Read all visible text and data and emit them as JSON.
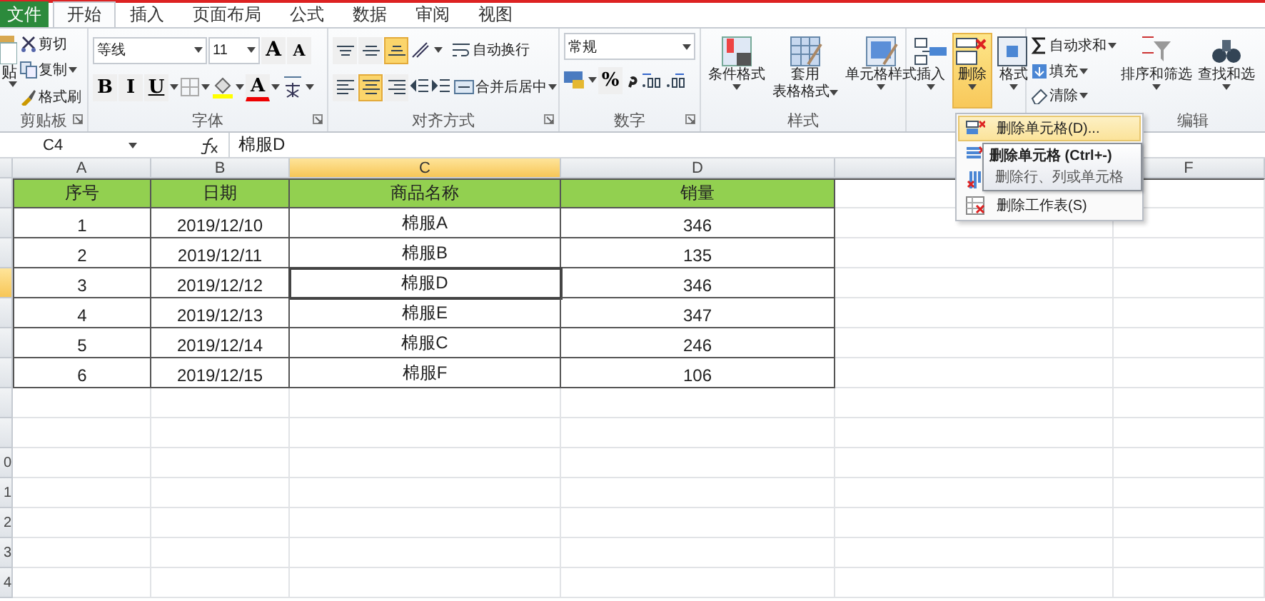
{
  "ribbon_tabs": [
    {
      "label": "文件",
      "kind": "file",
      "selected": false
    },
    {
      "label": "开始",
      "kind": "tab",
      "selected": true
    },
    {
      "label": "插入",
      "kind": "tab",
      "selected": false
    },
    {
      "label": "页面布局",
      "kind": "tab",
      "selected": false
    },
    {
      "label": "公式",
      "kind": "tab",
      "selected": false
    },
    {
      "label": "数据",
      "kind": "tab",
      "selected": false
    },
    {
      "label": "审阅",
      "kind": "tab",
      "selected": false
    },
    {
      "label": "视图",
      "kind": "tab",
      "selected": false
    }
  ],
  "clipboard": {
    "paste": "贴",
    "cut": "剪切",
    "copy": "复制",
    "format_painter": "格式刷",
    "label": "剪贴板"
  },
  "font": {
    "name": "等线",
    "size": "11",
    "grow": "A",
    "shrink": "A",
    "bold": "B",
    "italic": "I",
    "underline": "U",
    "font_color": "A",
    "label": "字体"
  },
  "alignment": {
    "vertical": [
      {
        "kind": "top",
        "selected": false
      },
      {
        "kind": "middle",
        "selected": false
      },
      {
        "kind": "bottom",
        "selected": true
      }
    ],
    "horizontal": [
      {
        "kind": "left",
        "selected": false
      },
      {
        "kind": "center",
        "selected": true
      },
      {
        "kind": "right",
        "selected": false
      }
    ],
    "wrap": "自动换行",
    "merge": "合并后居中",
    "label": "对齐方式"
  },
  "number": {
    "format": "常规",
    "percent": "%",
    "label": "数字"
  },
  "styles": {
    "buttons": [
      {
        "kind": "conditional",
        "lines": [
          "条件格式"
        ]
      },
      {
        "kind": "table",
        "lines": [
          "套用",
          "表格格式"
        ]
      },
      {
        "kind": "cell",
        "lines": [
          "单元格样式"
        ]
      }
    ],
    "label": "样式"
  },
  "cells": {
    "buttons": [
      {
        "kind": "insert",
        "label": "插入",
        "selected": false
      },
      {
        "kind": "delete",
        "label": "删除",
        "selected": true
      },
      {
        "kind": "format",
        "label": "格式",
        "selected": false
      }
    ]
  },
  "editing": {
    "small": [
      {
        "kind": "sum",
        "label": "自动求和"
      },
      {
        "kind": "fill",
        "label": "填充"
      },
      {
        "kind": "clear",
        "label": "清除"
      }
    ],
    "big": [
      {
        "kind": "sort",
        "label": "排序和筛选"
      },
      {
        "kind": "find",
        "label": "查找和选"
      }
    ],
    "label": "编辑"
  },
  "formula_bar": {
    "name_box": "C4",
    "formula": "棉服D"
  },
  "sheet": {
    "columns": [
      {
        "label": "A",
        "selected": false
      },
      {
        "label": "B",
        "selected": false
      },
      {
        "label": "C",
        "selected": true
      },
      {
        "label": "D",
        "selected": false
      },
      {
        "selected": false
      },
      {
        "label": "F",
        "selected": false
      }
    ],
    "rows": [
      {
        "kind": "header",
        "selected": false,
        "cells": [
          "序号",
          "日期",
          "商品名称",
          "销量"
        ]
      },
      {
        "kind": "data",
        "selected": false,
        "cells": [
          "1",
          "2019/12/10",
          "棉服A",
          "346"
        ]
      },
      {
        "kind": "data",
        "selected": false,
        "cells": [
          "2",
          "2019/12/11",
          "棉服B",
          "135"
        ]
      },
      {
        "kind": "data",
        "selected": true,
        "cells": [
          "3",
          "2019/12/12",
          "棉服D",
          "346"
        ]
      },
      {
        "kind": "data",
        "selected": false,
        "cells": [
          "4",
          "2019/12/13",
          "棉服E",
          "347"
        ]
      },
      {
        "kind": "data",
        "selected": false,
        "cells": [
          "5",
          "2019/12/14",
          "棉服C",
          "246"
        ]
      },
      {
        "kind": "data",
        "selected": false,
        "cells": [
          "6",
          "2019/12/15",
          "棉服F",
          "106"
        ]
      },
      {
        "kind": "blank",
        "selected": false
      },
      {
        "kind": "blank",
        "selected": false
      },
      {
        "kind": "blank",
        "selected": false,
        "number": "0"
      },
      {
        "kind": "blank",
        "selected": false,
        "number": "1"
      },
      {
        "kind": "blank",
        "selected": false,
        "number": "2"
      },
      {
        "kind": "blank",
        "selected": false,
        "number": "3"
      },
      {
        "kind": "blank",
        "selected": false,
        "number": "4"
      }
    ]
  },
  "delete_menu": {
    "items": [
      {
        "kind": "cells",
        "label": "删除单元格(D)...",
        "selected": true
      },
      {
        "kind": "rows",
        "selected": false
      },
      {
        "kind": "columns",
        "selected": false
      },
      {
        "kind": "sheet",
        "label": "删除工作表(S)",
        "selected": false
      }
    ]
  },
  "tooltip": {
    "title": "删除单元格 (Ctrl+-)",
    "text": "删除行、列或单元格"
  }
}
